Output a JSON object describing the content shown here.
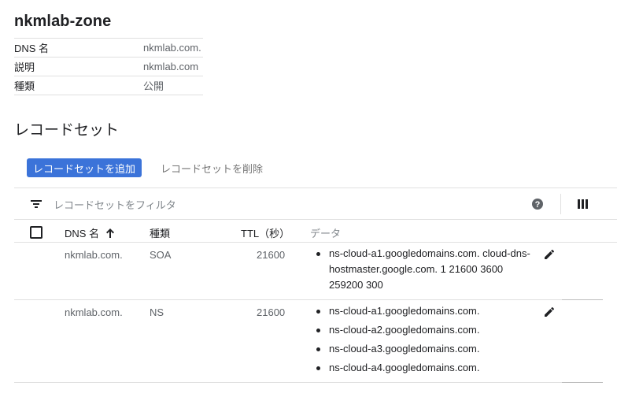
{
  "zone": {
    "title": "nkmlab-zone",
    "details": [
      {
        "label": "DNS 名",
        "value": "nkmlab.com."
      },
      {
        "label": "説明",
        "value": "nkmlab.com"
      },
      {
        "label": "種類",
        "value": "公開"
      }
    ]
  },
  "recordsets": {
    "section_title": "レコードセット",
    "add_button": "レコードセットを追加",
    "delete_button": "レコードセットを削除",
    "filter_placeholder": "レコードセットをフィルタ",
    "columns": {
      "dns_name": "DNS 名",
      "type": "種類",
      "ttl": "TTL（秒）",
      "data": "データ"
    },
    "rows": [
      {
        "dns_name": "nkmlab.com.",
        "type": "SOA",
        "ttl": "21600",
        "data": [
          "ns-cloud-a1.googledomains.com. cloud-dns-hostmaster.google.com. 1 21600 3600 259200 300"
        ]
      },
      {
        "dns_name": "nkmlab.com.",
        "type": "NS",
        "ttl": "21600",
        "data": [
          "ns-cloud-a1.googledomains.com.",
          "ns-cloud-a2.googledomains.com.",
          "ns-cloud-a3.googledomains.com.",
          "ns-cloud-a4.googledomains.com."
        ]
      }
    ]
  },
  "icons": {
    "filter": "filter-icon",
    "help": "help-icon",
    "columns": "columns-icon",
    "sort": "arrow-up-icon",
    "edit": "edit-icon"
  },
  "colors": {
    "primary_button": "#3b73d9",
    "border": "#e0e0e0",
    "muted_text": "#5f6368"
  }
}
